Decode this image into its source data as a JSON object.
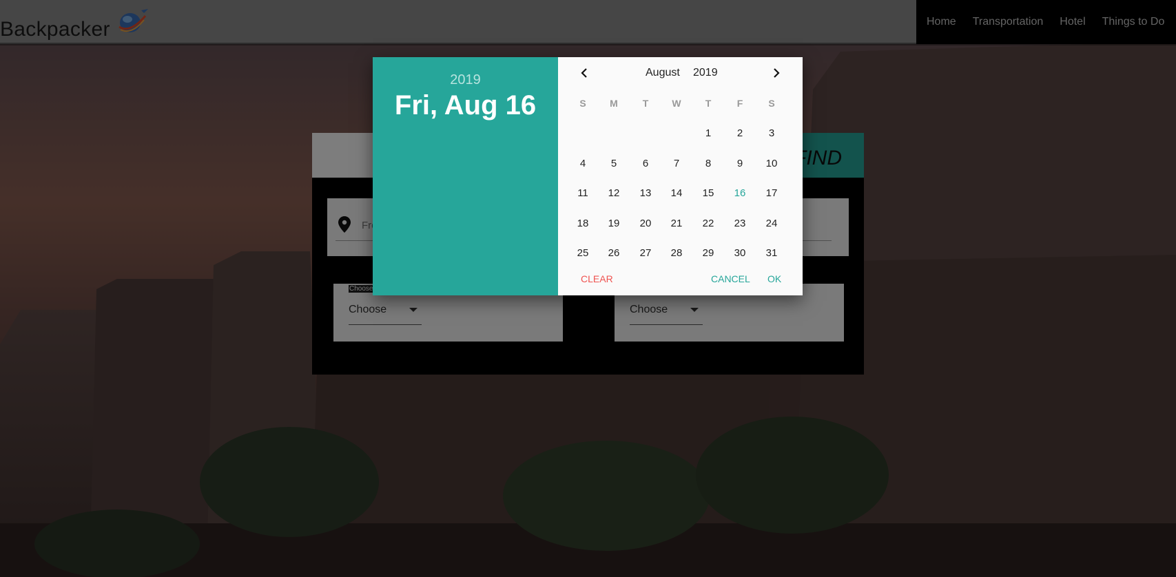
{
  "navbar": {
    "brand": "Backpacker",
    "links": [
      "Home",
      "Transportation",
      "Hotel",
      "Things to Do"
    ]
  },
  "search_panel": {
    "find_label": "FIND",
    "from_placeholder": "Fro",
    "choose_small": "Choose",
    "choose_value": "Choose"
  },
  "datepicker": {
    "year": "2019",
    "selected_date": "Fri, Aug 16",
    "month": "August",
    "header_year": "2019",
    "weekdays": [
      "S",
      "M",
      "T",
      "W",
      "T",
      "F",
      "S"
    ],
    "weeks": [
      [
        "",
        "",
        "",
        "",
        "1",
        "2",
        "3"
      ],
      [
        "4",
        "5",
        "6",
        "7",
        "8",
        "9",
        "10"
      ],
      [
        "11",
        "12",
        "13",
        "14",
        "15",
        "16",
        "17"
      ],
      [
        "18",
        "19",
        "20",
        "21",
        "22",
        "23",
        "24"
      ],
      [
        "25",
        "26",
        "27",
        "28",
        "29",
        "30",
        "31"
      ]
    ],
    "selected_day": "16",
    "clear_label": "CLEAR",
    "cancel_label": "CANCEL",
    "ok_label": "OK"
  },
  "colors": {
    "accent": "#26a69a",
    "clear": "#ef5350",
    "navbar_bg": "#8c8c8c",
    "nav_menu_bg": "#000000"
  },
  "icons": {
    "logo": "globe-plane-logo",
    "location": "location-pin-icon",
    "prev": "chevron-left-icon",
    "next": "chevron-right-icon",
    "dropdown": "caret-down-icon"
  }
}
